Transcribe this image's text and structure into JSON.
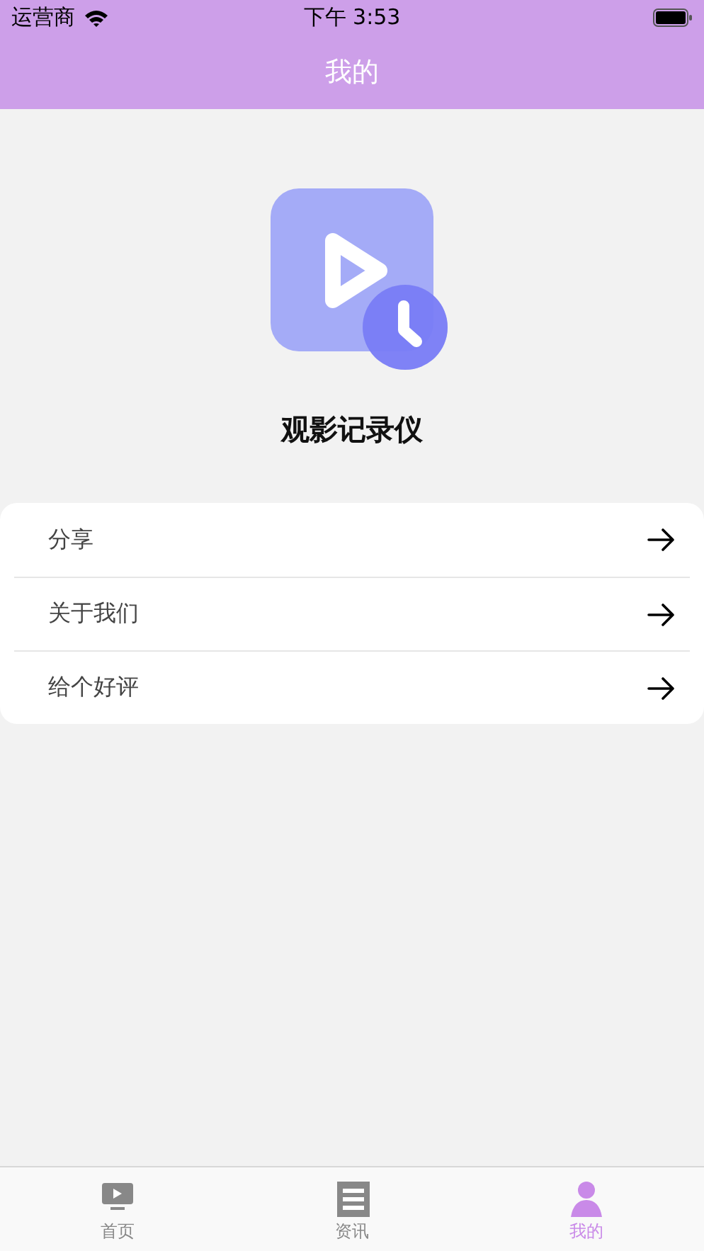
{
  "status_bar": {
    "carrier": "运营商",
    "time": "下午 3:53"
  },
  "nav": {
    "title": "我的"
  },
  "app": {
    "name": "观影记录仪"
  },
  "menu": [
    {
      "label": "分享"
    },
    {
      "label": "关于我们"
    },
    {
      "label": "给个好评"
    }
  ],
  "tabs": [
    {
      "label": "首页",
      "selected": false
    },
    {
      "label": "资讯",
      "selected": false
    },
    {
      "label": "我的",
      "selected": true
    }
  ]
}
